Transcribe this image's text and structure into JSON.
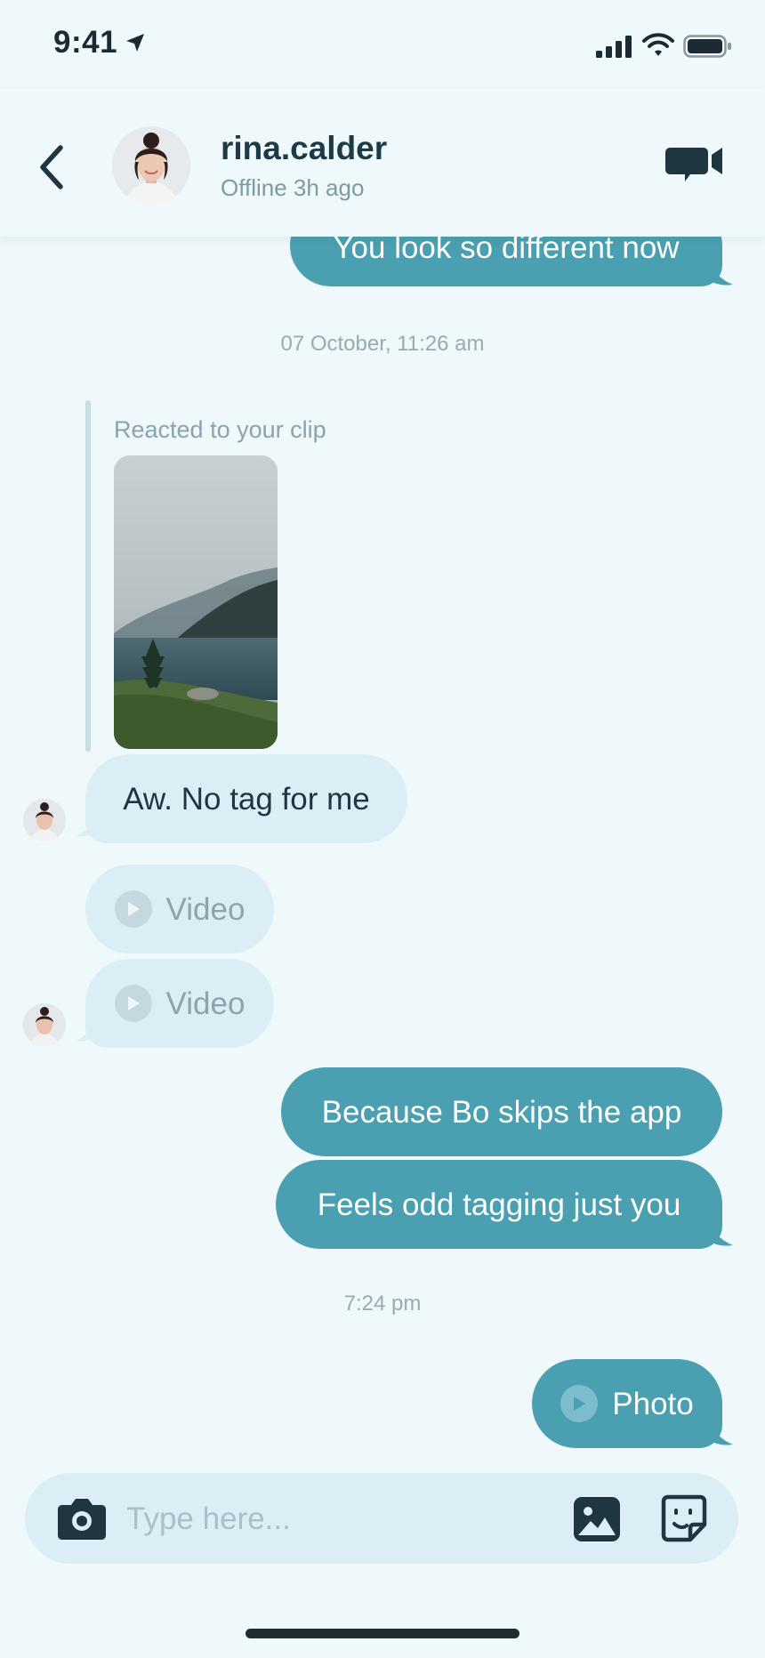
{
  "status_bar": {
    "time": "9:41"
  },
  "header": {
    "username": "rina.calder",
    "presence": "Offline 3h ago",
    "back_icon": "chevron-left-icon",
    "call_icon": "video-camera-icon"
  },
  "messages": {
    "partial_outgoing": "You look so different now",
    "timestamp_1": "07 October, 11:26 am",
    "reaction_label": "Reacted to your clip",
    "incoming_text": "Aw. No tag for me",
    "video_1": "Video",
    "video_2": "Video",
    "outgoing_1": "Because Bo skips the app",
    "outgoing_2": "Feels odd tagging just you",
    "timestamp_2": "7:24 pm",
    "photo": "Photo"
  },
  "composer": {
    "placeholder": "Type here...",
    "camera_icon": "camera-icon",
    "gallery_icon": "image-icon",
    "sticker_icon": "sticker-icon"
  },
  "colors": {
    "background": "#eff8fb",
    "outgoing_bubble": "#4a9fb0",
    "incoming_bubble": "#dceef5",
    "text_dark": "#1f3540",
    "muted": "#9aaab2"
  }
}
